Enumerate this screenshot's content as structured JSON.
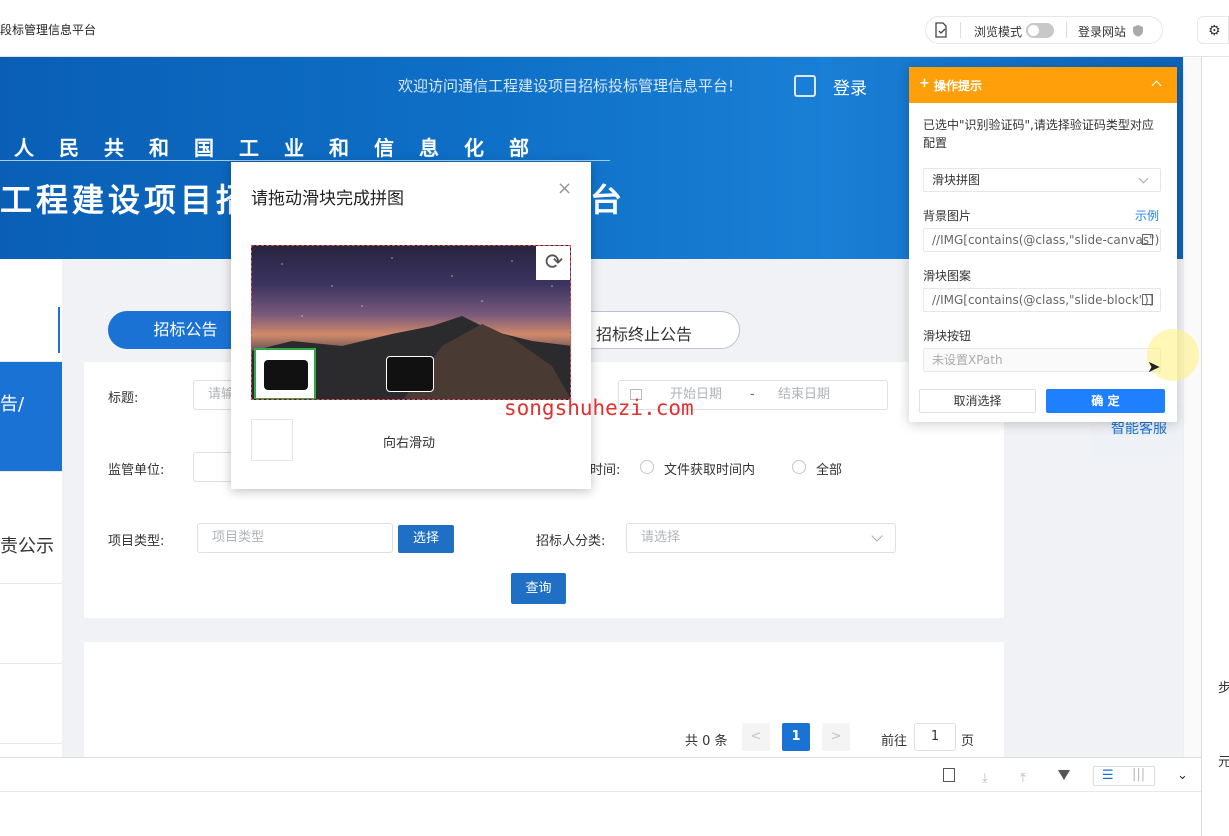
{
  "browser": {
    "tab_title": "段标管理信息平台",
    "browse_mode_label": "浏览模式",
    "login_site_label": "登录网站"
  },
  "header": {
    "welcome": "欢迎访问通信工程建设项目招标投标管理信息平台!",
    "login": "登录",
    "org": "人民共和国工业和信息化部",
    "system_title": "工程建设项目招"
  },
  "sidebar": {
    "items": [
      "告/",
      "责公示"
    ]
  },
  "tabs": {
    "active": "招标公告",
    "end_notice": "招标终止公告"
  },
  "form": {
    "title_label": "标题:",
    "title_placeholder": "请输",
    "start_date": "开始日期",
    "date_sep": "-",
    "end_date": "结束日期",
    "supervisor_label": "监管单位:",
    "time_label": "时间:",
    "radio_file_time": "文件获取时间内",
    "radio_all": "全部",
    "project_type_label": "项目类型:",
    "project_type_placeholder": "项目类型",
    "select_btn": "选择",
    "tenderee_label": "招标人分类:",
    "tenderee_placeholder": "请选择",
    "query_btn": "查询"
  },
  "pagination": {
    "total": "共 0 条",
    "prev": "<",
    "current_page": "1",
    "next": ">",
    "goto_label": "前往",
    "goto_value": "1",
    "page_suffix": "页"
  },
  "service": "智能客服",
  "captcha": {
    "title": "请拖动滑块完成拼图",
    "close": "×",
    "slide_hint": "向右滑动"
  },
  "watermark": "songshuhezi.com",
  "hint_panel": {
    "header": "操作提示",
    "description": "已选中\"识别验证码\",请选择验证码类型对应配置",
    "captcha_type": "滑块拼图",
    "bg_label": "背景图片",
    "example_link": "示例",
    "bg_xpath": "//IMG[contains(@class,\"slide-canvas\")]",
    "block_label": "滑块图案",
    "block_xpath": "//IMG[contains(@class,\"slide-block\")]",
    "button_label": "滑块按钮",
    "button_placeholder": "未设置XPath",
    "cancel_btn": "取消选择",
    "confirm_btn": "确 定"
  },
  "right_panel": {
    "label1": "步",
    "label2": "元"
  },
  "colors": {
    "accent_blue": "#1a73d4",
    "hint_orange": "#ff9f0a",
    "confirm_blue": "#1e80ff"
  }
}
